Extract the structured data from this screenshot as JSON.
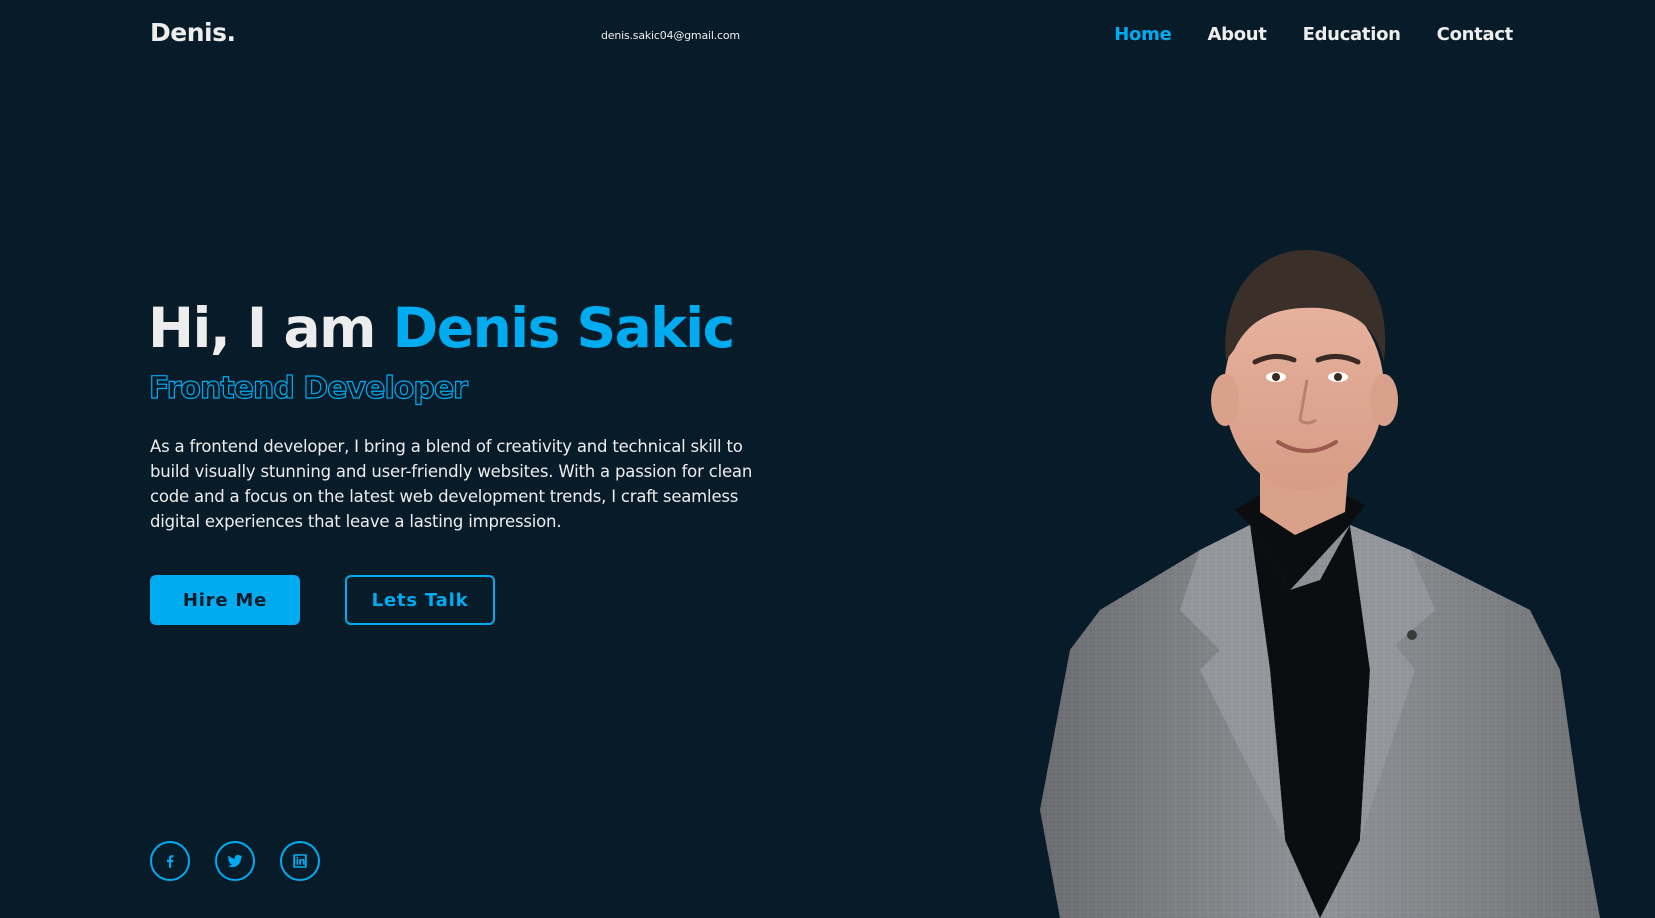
{
  "header": {
    "logo": "Denis.",
    "email": "denis.sakic04@gmail.com",
    "nav": [
      {
        "label": "Home",
        "active": true
      },
      {
        "label": "About",
        "active": false
      },
      {
        "label": "Education",
        "active": false
      },
      {
        "label": "Contact",
        "active": false
      }
    ]
  },
  "hero": {
    "greeting": "Hi, I am",
    "name": "Denis Sakic",
    "role": "Frontend Developer",
    "description": "As a frontend developer, I bring a blend of creativity and technical skill to build visually stunning and user-friendly websites. With a passion for clean code and a focus on the latest web development trends, I craft seamless digital experiences that leave a lasting impression.",
    "primary_button": "Hire Me",
    "secondary_button": "Lets Talk"
  },
  "socials": [
    {
      "icon": "facebook-icon"
    },
    {
      "icon": "twitter-icon"
    },
    {
      "icon": "linkedin-icon"
    }
  ],
  "colors": {
    "background": "#081b29",
    "accent": "#00abf0",
    "text": "#ededed"
  }
}
